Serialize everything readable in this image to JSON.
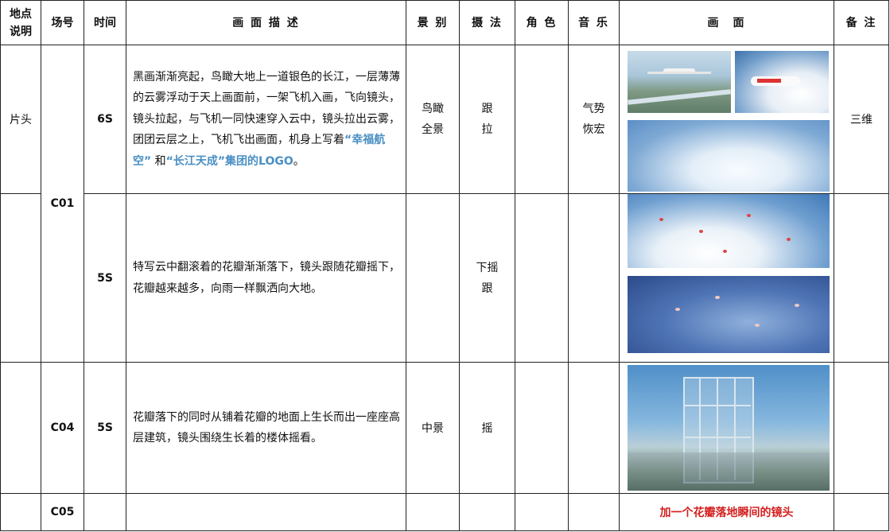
{
  "headers": {
    "location": "地点\n说明",
    "scene_no": "场号",
    "time": "时间",
    "description": "画 面 描 述",
    "shot_size": "景 别",
    "camera": "摄 法",
    "role": "角 色",
    "music": "音 乐",
    "picture": "画　面",
    "notes": "备 注"
  },
  "rows": [
    {
      "location": "片头",
      "scene": "C01",
      "time": "6S",
      "desc_plain": "黑画渐渐亮起，鸟瞰大地上一道银色的长江，一层薄薄的云雾浮动于天上画面前，一架飞机入画，飞向镜头，镜头拉起，与飞机一同快速穿入云中，镜头拉出云雾，团团云层之上，飞机飞出画面，机身上写着",
      "desc_hl1": "“幸福航空”",
      "desc_mid": " 和",
      "desc_hl2": "“长江天成”集团的LOGO",
      "desc_end": "。",
      "shot": "鸟瞰\n全景",
      "camera": "跟\n拉",
      "music": "气势\n恢宏",
      "notes": "三维"
    },
    {
      "time": "5S",
      "desc": "特写云中翻滚着的花瓣渐渐落下，镜头跟随花瓣摇下，花瓣越来越多，向雨一样飘洒向大地。",
      "camera": "下摇\n跟"
    },
    {
      "scene": "C04",
      "time": "5S",
      "desc": "花瓣落下的同时从铺着花瓣的地面上生长而出一座座高层建筑，镜头围绕生长着的楼体摇看。",
      "shot": "中景",
      "camera": "摇"
    },
    {
      "scene": "C05",
      "picture_note": "加一个花瓣落地瞬间的镜头"
    }
  ],
  "colors": {
    "highlight": "#4a8fc4",
    "note_red": "#d42020"
  },
  "images": [
    "plane-over-river",
    "plane-in-clouds-branded",
    "cloud-sky",
    "clouds-with-petals",
    "petals-falling-blue",
    "glass-tower-building"
  ]
}
